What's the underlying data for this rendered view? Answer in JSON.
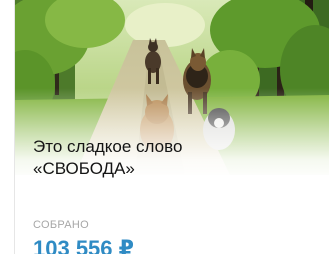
{
  "campaign": {
    "image_subject": "dogs-on-forest-path",
    "title_line1": "Это сладкое слово",
    "title_line2": "«СВОБОДА»",
    "raised_label": "СОБРАНО",
    "raised_amount": "103 556 ₽"
  },
  "colors": {
    "amount": "#2f8bc4",
    "label": "#a7a7a7",
    "title": "#141414"
  }
}
